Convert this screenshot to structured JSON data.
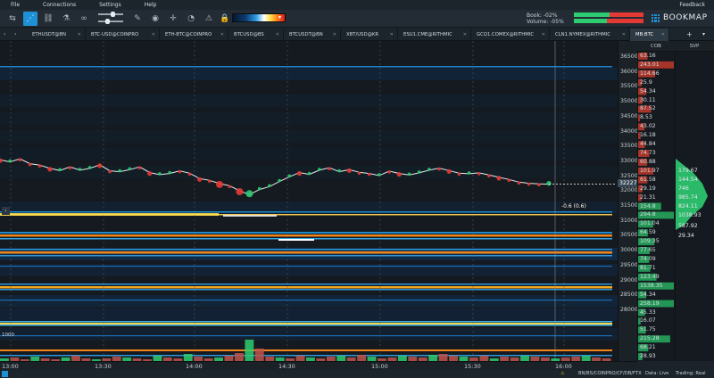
{
  "menu": {
    "items": [
      "File",
      "Connections",
      "Settings",
      "Help"
    ],
    "feedback": "Feedback"
  },
  "toolbar": {
    "tools": [
      {
        "name": "tab-layout-icon",
        "glyph": "⇆",
        "active": false
      },
      {
        "name": "share-connections-icon",
        "glyph": "⋰",
        "active": true
      },
      {
        "name": "link-icon",
        "glyph": "⛓",
        "active": false
      },
      {
        "name": "order-book-icon",
        "glyph": "⚗",
        "active": false
      },
      {
        "name": "chain-link-icon",
        "glyph": "∞",
        "active": false
      },
      {
        "name": "pen-icon",
        "glyph": "✎",
        "active": false
      },
      {
        "name": "target-icon",
        "glyph": "◉",
        "active": false
      },
      {
        "name": "crosshair-icon",
        "glyph": "✛",
        "active": false
      },
      {
        "name": "stopwatch-icon",
        "glyph": "◔",
        "active": false
      },
      {
        "name": "alert-icon",
        "glyph": "⚠",
        "active": false
      },
      {
        "name": "lock-icon",
        "glyph": "🔒",
        "active": false
      }
    ],
    "book_label": "Book:",
    "book_value": "-02%",
    "volume_label": "Volume:",
    "volume_value": "-05%",
    "brand": "BOOKMAP"
  },
  "tabs": [
    "ETHUSDT@BN",
    "BTC-USD@COINPRO",
    "ETH-BTC@COINPRO",
    "BTCUSD@BS",
    "BTCUSDT@BN",
    "XBT/USD@KR",
    "ESU1.CME@RITHMIC",
    "GCQ1.COMEX@RITHMIC",
    "CLN1.NYMEX@RITHMIC",
    "MB:BTC"
  ],
  "active_tab": "MB:BTC",
  "columns": {
    "cob": "COB",
    "svp": "SVP"
  },
  "chart": {
    "current_price": "32227",
    "cursor_readout": "-0.6 (0.6)",
    "size_label": "1000",
    "price_levels": [
      "36500",
      "36000",
      "35500",
      "35000",
      "34500",
      "34000",
      "33500",
      "33000",
      "32500",
      "32000",
      "31500",
      "31000",
      "30500",
      "30000",
      "29500",
      "29000",
      "28500",
      "28000"
    ],
    "time_labels": [
      "13:00",
      "13:30",
      "14:00",
      "14:30",
      "15:00",
      "15:30",
      "16:00"
    ],
    "price_line": [
      33050,
      32980,
      33080,
      32920,
      32870,
      32760,
      32690,
      32810,
      32700,
      32760,
      32880,
      32680,
      32650,
      32720,
      32810,
      32620,
      32550,
      32590,
      32680,
      32600,
      32420,
      32360,
      32250,
      32180,
      32010,
      31880,
      32050,
      32150,
      32320,
      32480,
      32620,
      32560,
      32700,
      32780,
      32650,
      32720,
      32630,
      32590,
      32520,
      32670,
      32590,
      32540,
      32610,
      32700,
      32770,
      32690,
      32600,
      32580,
      32610,
      32540,
      32460,
      32390,
      32300,
      32260,
      32240,
      32230
    ]
  },
  "cob_values": [
    "63.16",
    "243.01",
    "114.66",
    "25.9",
    "54.34",
    "30.11",
    "87.52",
    "8.53",
    "43.02",
    "16.18",
    "44.84",
    "74.73",
    "60.88",
    "101.97",
    "61.58",
    "29.19",
    "21.31",
    "154.8",
    "294.8",
    "101.04",
    "64.59",
    "109.35",
    "77.65",
    "74.09",
    "81.71",
    "123.49",
    "1538.35",
    "54.34",
    "258.19",
    "45.33",
    "16.07",
    "51.75",
    "215.28",
    "68.21",
    "28.93"
  ],
  "svp_values": [
    "179.67",
    "144.54",
    "746",
    "985.74",
    "824.11",
    "1038.93",
    "587.92",
    "29.34"
  ],
  "status": {
    "feeds": "BN/BS/COINPRO/CF/DB/FTX",
    "data": "Data: Live",
    "trading": "Trading: Real"
  },
  "colors": {
    "accent": "#1e90d6",
    "bid": "#2ecc71",
    "ask": "#e53935",
    "heat_hot": "#ff8a1a",
    "heat_cold": "#0c3d74"
  }
}
